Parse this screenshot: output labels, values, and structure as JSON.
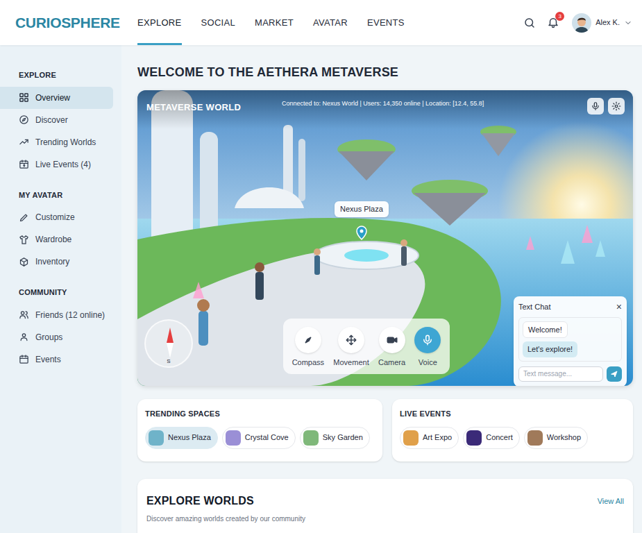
{
  "logo": "CURIOSPHERE",
  "nav": [
    {
      "label": "EXPLORE",
      "selected": true
    },
    {
      "label": "SOCIAL",
      "selected": false
    },
    {
      "label": "MARKET",
      "selected": false
    },
    {
      "label": "AVATAR",
      "selected": false
    },
    {
      "label": "EVENTS",
      "selected": false
    }
  ],
  "header": {
    "notifications": "3",
    "user": "Alex K."
  },
  "sidebar": {
    "sections": [
      {
        "title": "EXPLORE",
        "items": [
          {
            "label": "Overview",
            "selected": true
          },
          {
            "label": "Discover",
            "selected": false
          },
          {
            "label": "Trending Worlds",
            "selected": false
          },
          {
            "label": "Live Events (4)",
            "selected": false
          }
        ]
      },
      {
        "title": "MY AVATAR",
        "items": [
          {
            "label": "Customize",
            "selected": false
          },
          {
            "label": "Wardrobe",
            "selected": false
          },
          {
            "label": "Inventory",
            "selected": false
          }
        ]
      },
      {
        "title": "COMMUNITY",
        "items": [
          {
            "label": "Friends (12 online)",
            "selected": false
          },
          {
            "label": "Groups",
            "selected": false
          },
          {
            "label": "Events",
            "selected": false
          }
        ]
      }
    ]
  },
  "page_title": "WELCOME TO THE AETHERA METAVERSE",
  "world": {
    "title": "METAVERSE WORLD",
    "status": "Connected to: Nexus World | Users: 14,350 online | Location: [12.4, 55.8]",
    "pin": "Nexus Plaza",
    "compass_label": "S",
    "controls": [
      {
        "label": "Compass",
        "selected": false
      },
      {
        "label": "Movement",
        "selected": false
      },
      {
        "label": "Camera",
        "selected": false
      },
      {
        "label": "Voice",
        "selected": true
      }
    ],
    "chat": {
      "title": "Text Chat",
      "close": "×",
      "messages": [
        {
          "text": "Welcome!",
          "kind": "received"
        },
        {
          "text": "Let's explore!",
          "kind": "sent"
        }
      ],
      "placeholder": "Text message..."
    }
  },
  "trending": {
    "title": "TRENDING SPACES",
    "items": [
      {
        "label": "Nexus Plaza",
        "selected": true,
        "color": "#6fb3c9"
      },
      {
        "label": "Crystal Cove",
        "selected": false,
        "color": "#9a8fd6"
      },
      {
        "label": "Sky Garden",
        "selected": false,
        "color": "#7fb87a"
      }
    ]
  },
  "events": {
    "title": "LIVE EVENTS",
    "items": [
      {
        "label": "Art Expo",
        "color": "#e0a04a"
      },
      {
        "label": "Concert",
        "color": "#3b2a78"
      },
      {
        "label": "Workshop",
        "color": "#a07a5a"
      }
    ]
  },
  "explore": {
    "title": "EXPLORE WORLDS",
    "subtitle": "Discover amazing worlds created by our community",
    "link": "View All"
  }
}
